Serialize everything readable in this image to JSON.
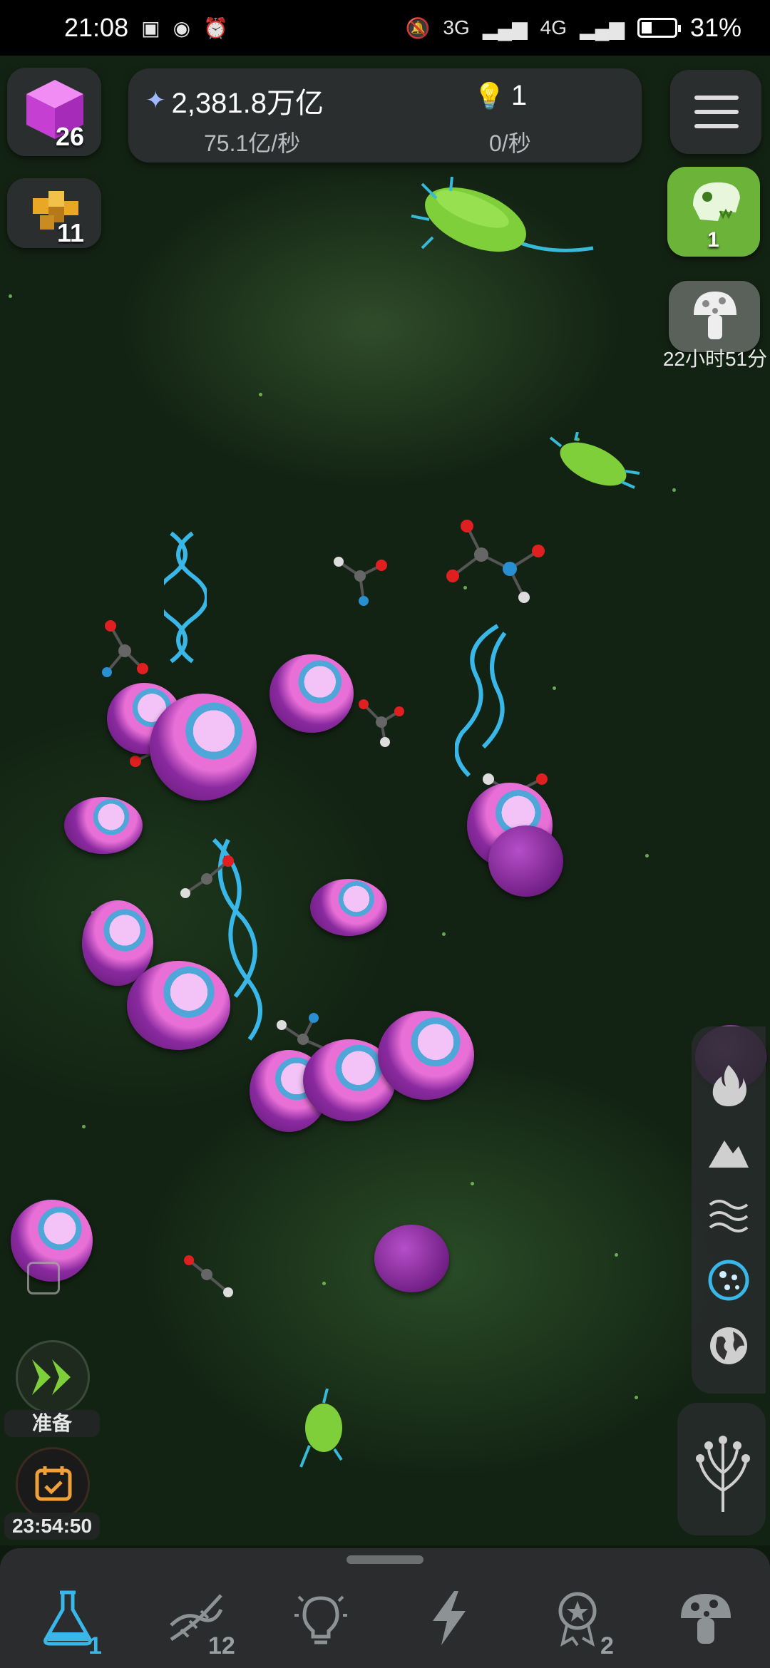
{
  "status_bar": {
    "time": "21:08",
    "network_1": "3G",
    "network_2": "4G",
    "battery": "31%"
  },
  "top_left": {
    "cube_count": "26",
    "gold_count": "11"
  },
  "resources": {
    "primary_amount": "2,381.8万亿",
    "primary_rate": "75.1亿/秒",
    "idea_amount": "1",
    "idea_rate": "0/秒"
  },
  "right_top": {
    "dino_count": "1",
    "mushroom_timer": "22小时51分"
  },
  "left_bottom": {
    "boost_label": "准备",
    "event_timer": "23:54:50"
  },
  "bottom_nav": {
    "tabs": [
      {
        "icon": "flask-icon",
        "count": "1",
        "active": true
      },
      {
        "icon": "dna-icon",
        "count": "12",
        "active": false
      },
      {
        "icon": "lightbulb-icon",
        "count": "",
        "active": false
      },
      {
        "icon": "lightning-icon",
        "count": "",
        "active": false
      },
      {
        "icon": "medal-icon",
        "count": "2",
        "active": false
      },
      {
        "icon": "mushroom-icon",
        "count": "",
        "active": false
      }
    ]
  },
  "side_menu": [
    "fire-icon",
    "mountain-icon",
    "water-icon",
    "cell-icon",
    "globe-icon"
  ],
  "colors": {
    "accent_active": "#38b7e8",
    "accent_green": "#7ecf3a",
    "panel": "#2d3032",
    "cell_purple": "#8a2aa0"
  }
}
